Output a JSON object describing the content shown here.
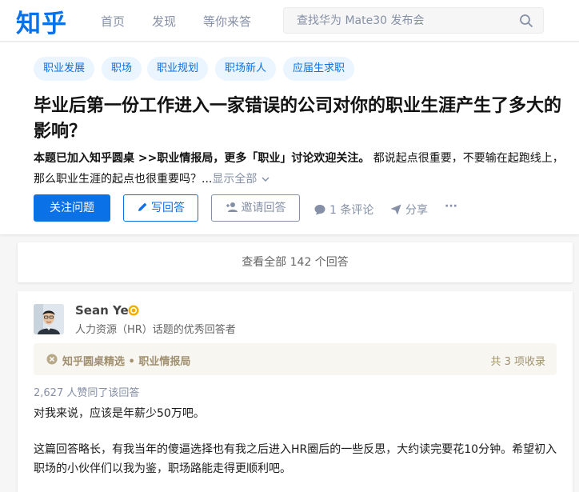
{
  "header": {
    "logo": "知乎",
    "nav": [
      "首页",
      "发现",
      "等你来答"
    ],
    "search_placeholder": "查找华为 Mate30 发布会"
  },
  "question": {
    "tags": [
      "职业发展",
      "职场",
      "职业规划",
      "职场新人",
      "应届生求职"
    ],
    "title": "毕业后第一份工作进入一家错误的公司对你的职业生涯产生了多大的影响？",
    "roundtable_prefix": "本题已加入知乎圆桌 >>",
    "roundtable_name": "职业情报局",
    "roundtable_suffix": "，更多「职业」讨论欢迎关注。",
    "excerpt": " 都说起点很重要，不要输在起跑线上，那么职业生涯的起点也很重要吗？...",
    "show_all": "显示全部",
    "follow_label": "关注问题",
    "write_label": "写回答",
    "invite_label": "邀请回答",
    "comments_label": "1 条评论",
    "share_label": "分享",
    "more_label": "···"
  },
  "view_all_label": "查看全部 142 个回答",
  "answer": {
    "author_name": "Sean Ye",
    "author_desc": "人力资源（HR）话题的优秀回答者",
    "collection_text": "知乎圆桌精选 • 职业情报局",
    "collection_count": "共 3 项收录",
    "votes": "2,627 人赞同了该回答",
    "paragraphs": [
      "对我来说，应该是年薪少50万吧。",
      "这篇回答略长，有我当年的傻逼选择也有我之后进入HR圈后的一些反思，大约读完要花10分钟。希望初入职场的小伙伴们以我为鉴，职场路能走得更顺利吧。"
    ]
  },
  "colors": {
    "brand": "#0a71e6",
    "muted": "#8590a6",
    "gold": "#a0906e"
  }
}
